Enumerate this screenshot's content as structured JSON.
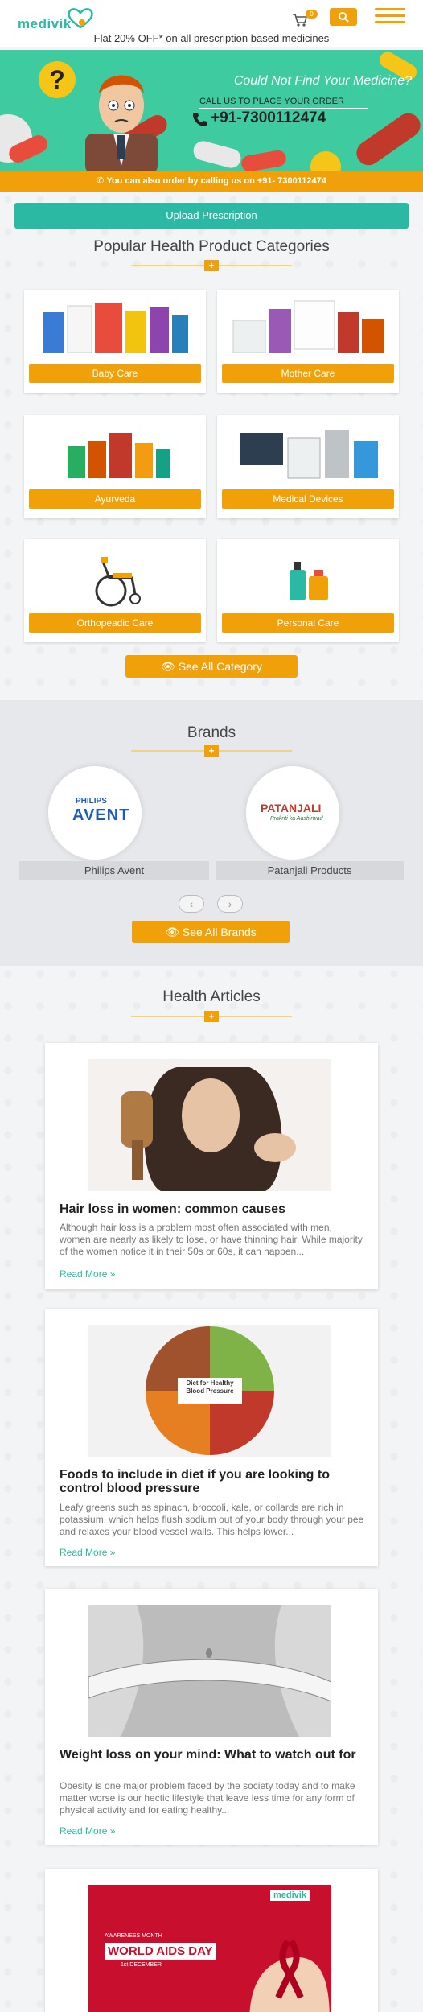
{
  "header": {
    "logo_text": "medivik",
    "cart_count": "0",
    "offer_text": "Flat 20% OFF* on all prescription based medicines"
  },
  "banner": {
    "title": "Could Not Find Your Medicine?",
    "call_text": "CALL US TO PLACE YOUR ORDER",
    "phone": "+91-7300112474",
    "qmark": "?"
  },
  "callbar": {
    "text": "You can also order by calling us on +91- 7300112474"
  },
  "upload_button": "Upload Prescription",
  "categories": {
    "title": "Popular Health Product Categories",
    "items": [
      {
        "label": "Baby Care"
      },
      {
        "label": "Mother Care"
      },
      {
        "label": "Ayurveda"
      },
      {
        "label": "Medical Devices"
      },
      {
        "label": "Orthopeadic Care"
      },
      {
        "label": "Personal Care"
      }
    ],
    "see_all": "See All Category"
  },
  "brands": {
    "title": "Brands",
    "items": [
      {
        "name": "Philips Avent",
        "logo_top": "PHILIPS",
        "logo_main": "AVENT"
      },
      {
        "name": "Patanjali Products",
        "logo_main": "PATANJALI",
        "logo_sub": "Prakriti ka Aashirwad"
      }
    ],
    "prev": "‹",
    "next": "›",
    "see_all": "See All Brands"
  },
  "articles": {
    "title": "Health Articles",
    "items": [
      {
        "title": "Hair loss in women: common causes",
        "body": "Although hair loss is a problem most often associated with men, women are nearly as likely to lose, or have thinning hair. While majority of the women notice it in their 50s or 60s, it can happen...",
        "more": "Read More »"
      },
      {
        "title": "Foods to include in diet if you are looking to control blood pressure",
        "body": "Leafy greens such as spinach, broccoli, kale, or collards are rich in potassium, which helps flush sodium out of your body through your pee and relaxes your blood vessel walls. This helps lower...",
        "more": "Read More »",
        "image_caption": "Diet for Healthy Blood Pressure"
      },
      {
        "title": "Weight loss on your mind: What to watch out for",
        "body": "Obesity is one major problem faced by the society today and to make matter worse is our hectic lifestyle that leave less time for any form of physical activity and for eating healthy...",
        "more": "Read More »"
      },
      {
        "image_logo": "medivik",
        "image_small": "AWARENESS MONTH",
        "image_title": "WORLD AIDS DAY",
        "image_date": "1st DECEMBER"
      }
    ]
  },
  "colors": {
    "teal": "#2bb9a3",
    "orange": "#f0a10a",
    "banner_green": "#3ecb9f"
  }
}
